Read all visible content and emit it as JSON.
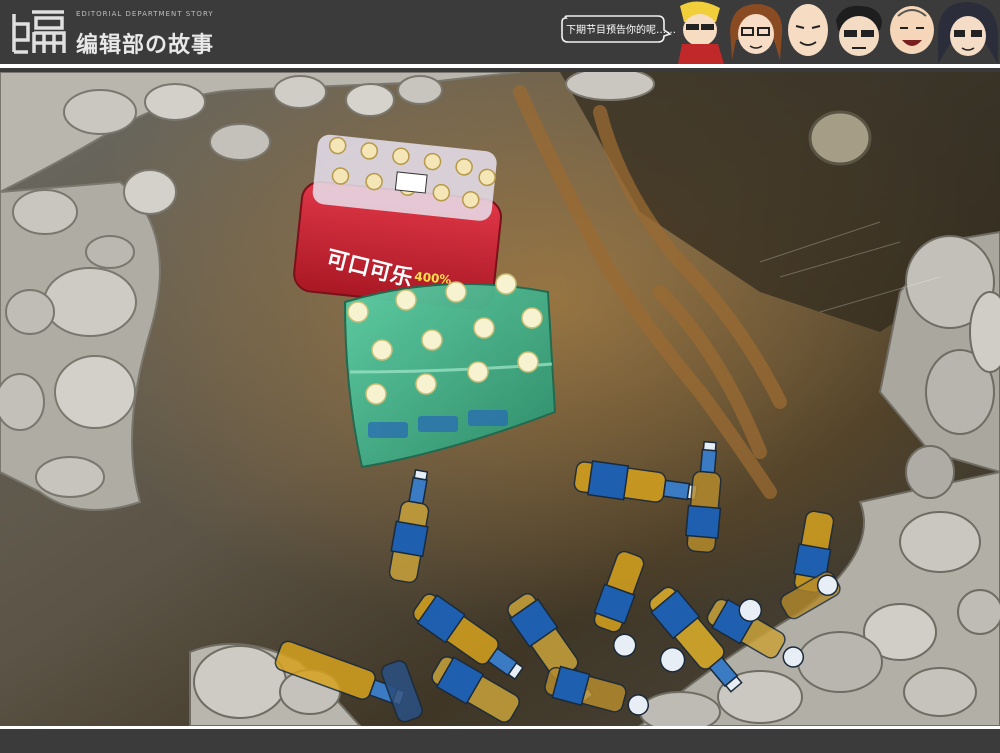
{
  "header": {
    "logo_char": "编",
    "logo_subtitle": "EDITORIAL DEPARTMENT STORY",
    "logo_title": "编辑部の故事",
    "bubble_text": "下期节目预告你的呢……",
    "characters": [
      "blonde-sunglasses-character",
      "brown-hair-character",
      "bald-character",
      "glasses-character",
      "round-face-character",
      "dark-hair-character"
    ]
  },
  "photo": {
    "subject": "drinks-cooling-in-stone-pond",
    "pack_red_label": "可口可乐 400%",
    "colors": {
      "water": "#5a5240",
      "stone": "#b9b8b0",
      "red_pack": "#d8283a",
      "green_pack": "#3fae8a",
      "bottle_label": "#1f5fb0",
      "beer_liquid": "#d6a21e"
    }
  }
}
